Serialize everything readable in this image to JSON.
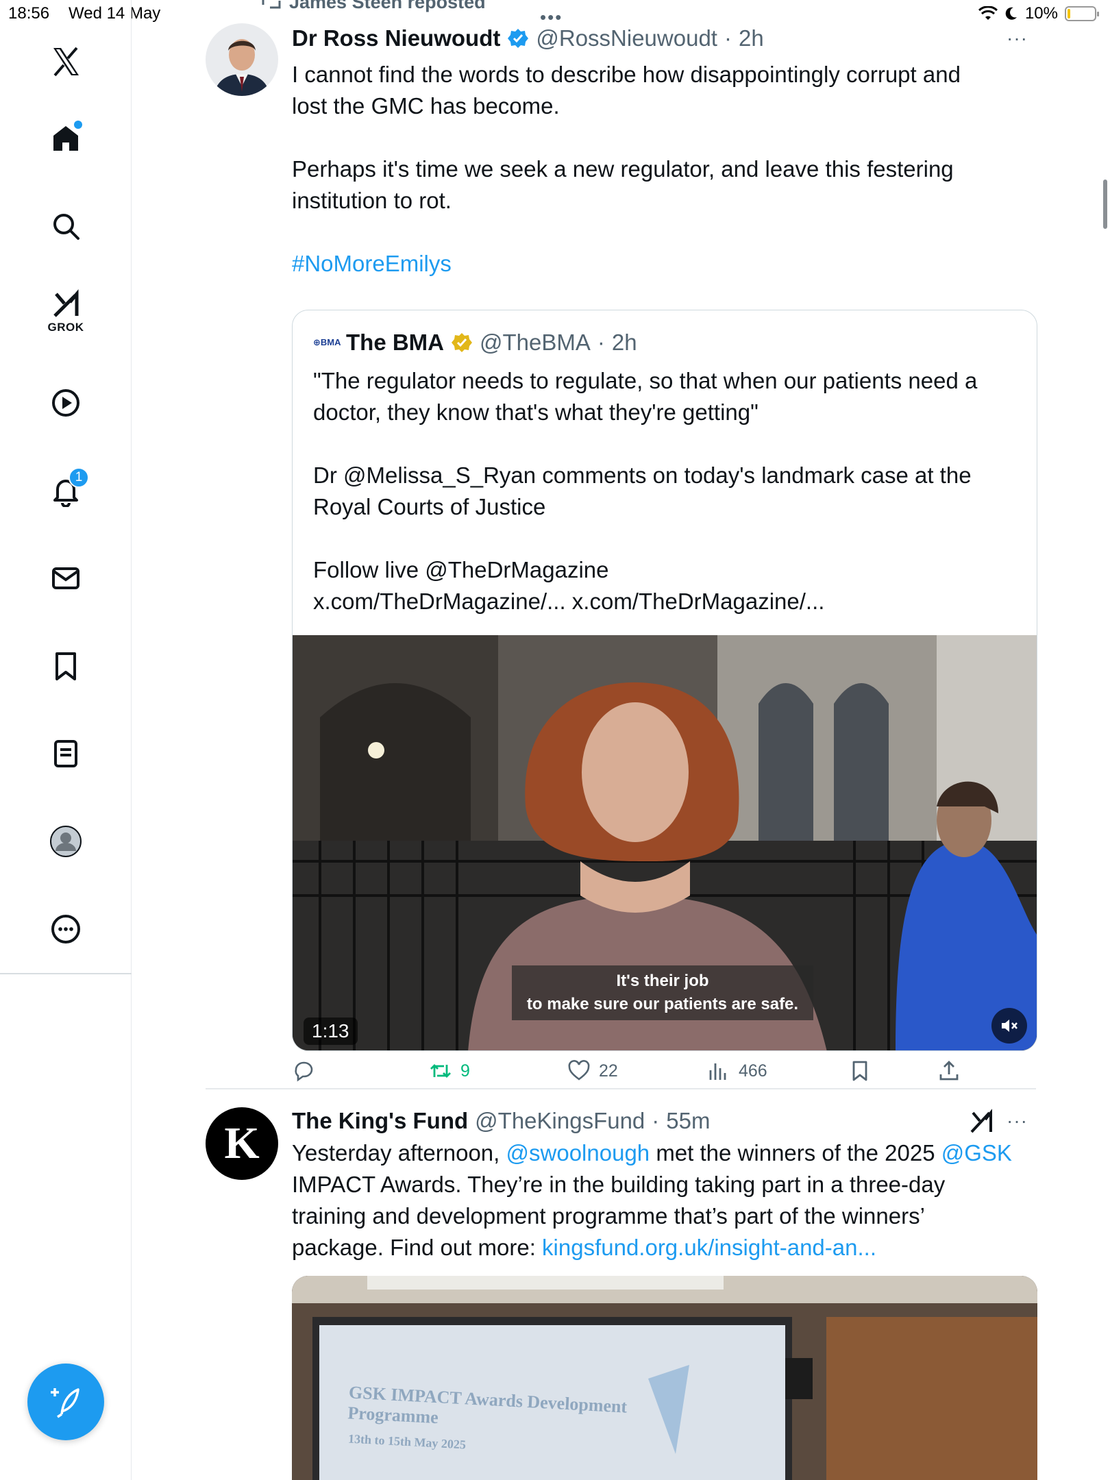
{
  "status": {
    "time": "18:56",
    "date": "Wed 14 May",
    "battery": "10%",
    "battery_level": 0.1
  },
  "sidebar": {
    "grok_label": "GROK",
    "notifications_count": "1"
  },
  "repost": {
    "label": "James Steen reposted"
  },
  "tweet1": {
    "name": "Dr Ross Nieuwoudt",
    "handle": "@RossNieuwoudt",
    "time": "2h",
    "text_1": "I cannot find the words to describe how disappointingly corrupt and",
    "text_2": "lost the GMC has become.",
    "text_3": "Perhaps it's time we seek a new regulator, and leave this festering",
    "text_4": "institution to rot.",
    "hashtag": "#NoMoreEmilys",
    "quote": {
      "logo": "⊕BMA",
      "name": "The BMA",
      "handle": "@TheBMA",
      "time": "2h",
      "text_1": "\"The regulator needs to regulate, so that when our patients need a",
      "text_2": "doctor, they know that's what they're getting\"",
      "text_3": "Dr @Melissa_S_Ryan comments on today's landmark case at the",
      "text_4": "Royal Courts of Justice",
      "text_5": "Follow live @TheDrMagazine",
      "text_6": "x.com/TheDrMagazine/... x.com/TheDrMagazine/...",
      "subtitle_1": "It's their job",
      "subtitle_2": "to make sure our patients are safe.",
      "duration": "1:13"
    },
    "actions": {
      "replies": "",
      "reposts": "9",
      "likes": "22",
      "views": "466"
    }
  },
  "tweet2": {
    "avatar_letter": "K",
    "name": "The King's Fund",
    "handle": "@TheKingsFund",
    "time": "55m",
    "text_a": "Yesterday afternoon, ",
    "mention_1": "@swoolnough",
    "text_b": " met the winners of the 2025 ",
    "mention_2": "@GSK",
    "text_2": "IMPACT Awards. They’re in the building taking part in a three-day",
    "text_3": "training and development programme that’s part of the winners’",
    "text_4a": "package. Find out more: ",
    "link": "kingsfund.org.uk/insight-and-an...",
    "slide_title_1": "GSK IMPACT Awards Development",
    "slide_title_2": "Programme",
    "slide_date": "13th to 15th May 2025"
  },
  "colors": {
    "accent": "#1d9bf0",
    "repost_green": "#00ba7c",
    "verified_gold": "#e2b719",
    "text_secondary": "#536471"
  },
  "icons": [
    "x-logo-icon",
    "home-icon",
    "search-icon",
    "grok-icon",
    "play-icon",
    "bell-icon",
    "mail-icon",
    "bookmark-icon",
    "list-icon",
    "profile-icon",
    "more-circle-icon",
    "compose-icon",
    "reply-icon",
    "repost-icon",
    "like-icon",
    "views-icon",
    "bookmark-icon",
    "share-icon",
    "mute-icon",
    "verified-icon"
  ]
}
